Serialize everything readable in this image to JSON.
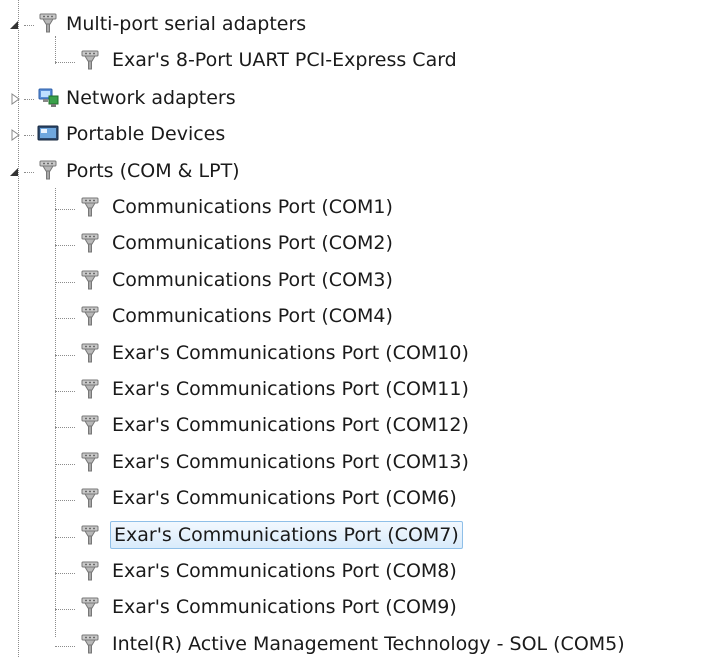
{
  "tree": {
    "multiport": {
      "label": "Multi-port serial adapters",
      "expanded": true,
      "children": [
        "Exar's 8-Port UART PCI-Express Card"
      ]
    },
    "network": {
      "label": "Network adapters",
      "expanded": false
    },
    "portable": {
      "label": "Portable Devices",
      "expanded": false
    },
    "ports": {
      "label": "Ports (COM & LPT)",
      "expanded": true,
      "children": [
        "Communications Port (COM1)",
        "Communications Port (COM2)",
        "Communications Port (COM3)",
        "Communications Port (COM4)",
        "Exar's Communications Port (COM10)",
        "Exar's Communications Port (COM11)",
        "Exar's Communications Port (COM12)",
        "Exar's Communications Port (COM13)",
        "Exar's Communications Port (COM6)",
        "Exar's Communications Port (COM7)",
        "Exar's Communications Port (COM8)",
        "Exar's Communications Port (COM9)",
        "Intel(R) Active Management Technology - SOL (COM5)"
      ],
      "selected": "Exar's Communications Port (COM7)"
    }
  },
  "icons": {
    "port": "serial-port-icon",
    "network": "network-adapter-icon",
    "portable": "portable-device-icon"
  },
  "colors": {
    "selection_fill": "#d9ebfb",
    "selection_border": "#8fbfe8",
    "tree_line": "#8c8c8c"
  }
}
